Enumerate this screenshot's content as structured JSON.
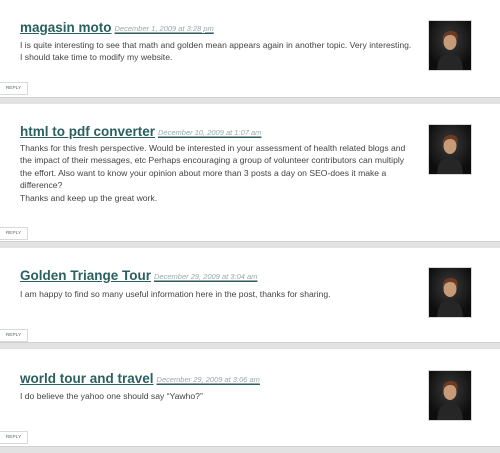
{
  "comments": [
    {
      "author": "magasin moto",
      "date": "December 1, 2009 at 3:28 pm",
      "lines": [
        "I is quite interesting to see that math and golden mean appears again in another topic. Very interesting. I should take time to modify my website."
      ],
      "reply_label": "REPLY"
    },
    {
      "author": "html to pdf converter",
      "date": "December 10, 2009 at 1:07 am",
      "lines": [
        "Thanks for this fresh perspective. Would be interested in your assessment of health related blogs and the impact of their messages, etc Perhaps encouraging a group of volunteer contributors can multiply the effort. Also want to know your opinion about more than 3 posts a day on SEO-does it make a difference?",
        "Thanks and keep up the great work."
      ],
      "reply_label": "REPLY"
    },
    {
      "author": "Golden Triange Tour",
      "date": "December 29, 2009 at 3:04 am",
      "lines": [
        "I am happy to find so many useful information here in the post, thanks for sharing."
      ],
      "reply_label": "REPLY"
    },
    {
      "author": "world tour and travel",
      "date": "December 29, 2009 at 3:06 am",
      "lines": [
        "I do believe the yahoo one should say “Yawho?”"
      ],
      "reply_label": "REPLY"
    }
  ],
  "avatar_icon": "user-avatar-icon"
}
